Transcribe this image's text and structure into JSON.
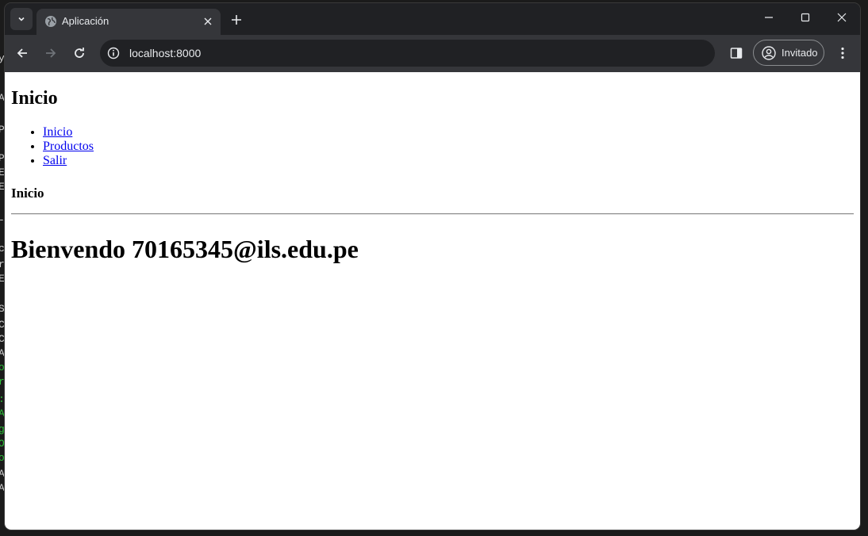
{
  "browser": {
    "tab_title": "Aplicación",
    "url": "localhost:8000",
    "profile_label": "Invitado"
  },
  "icons": {
    "tab_search": "chevron-down-icon",
    "favicon": "globe-icon",
    "tab_close": "close-icon",
    "new_tab": "plus-icon",
    "minimize": "minimize-icon",
    "maximize": "maximize-icon",
    "window_close": "close-icon",
    "back": "arrow-left-icon",
    "forward": "arrow-right-icon",
    "reload": "reload-icon",
    "site_info": "info-icon",
    "side_panel": "side-panel-icon",
    "profile": "person-icon",
    "menu": "kebab-menu-icon"
  },
  "page": {
    "heading": "Inicio",
    "nav": [
      {
        "label": "Inicio"
      },
      {
        "label": "Productos"
      },
      {
        "label": "Salir"
      }
    ],
    "section_title": "Inicio",
    "welcome": "Bienvendo 70165345@ils.edu.pe"
  },
  "colors": {
    "chrome_dark": "#202124",
    "chrome_toolbar": "#35363a",
    "link": "#0000ee"
  }
}
